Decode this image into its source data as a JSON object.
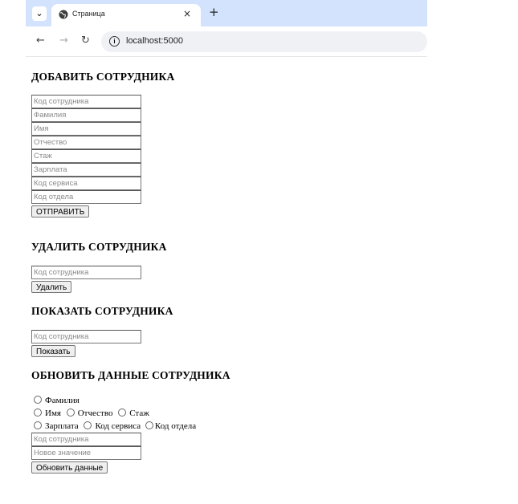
{
  "browser": {
    "tab_title": "Страница",
    "tab_close": "×",
    "new_tab": "+",
    "url": "localhost:5000",
    "icons": {
      "tab_menu": "chevron-down-icon",
      "favicon": "globe-icon",
      "back": "back-arrow-icon",
      "forward": "forward-arrow-icon",
      "reload": "reload-icon",
      "site_info": "info-icon"
    }
  },
  "add_employee": {
    "title": "ДОБАВИТЬ СОТРУДНИКА",
    "fields": [
      {
        "placeholder": "Код сотрудника",
        "value": ""
      },
      {
        "placeholder": "Фамилия",
        "value": ""
      },
      {
        "placeholder": "Имя",
        "value": ""
      },
      {
        "placeholder": "Отчество",
        "value": ""
      },
      {
        "placeholder": "Стаж",
        "value": ""
      },
      {
        "placeholder": "Зарплата",
        "value": ""
      },
      {
        "placeholder": "Код сервиса",
        "value": ""
      },
      {
        "placeholder": "Код отдела",
        "value": ""
      }
    ],
    "submit_label": "ОТПРАВИТЬ"
  },
  "delete_employee": {
    "title": "УДАЛИТЬ СОТРУДНИКА",
    "field_placeholder": "Код сотрудника",
    "button_label": "Удалить"
  },
  "show_employee": {
    "title": "ПОКАЗАТЬ СОТРУДНИКА",
    "field_placeholder": "Код сотрудника",
    "button_label": "Показать"
  },
  "update_employee": {
    "title": "ОБНОВИТЬ ДАННЫЕ СОТРУДНИКА",
    "radios": [
      "Фамилия",
      "Имя",
      "Отчество",
      "Стаж",
      "Зарплата",
      "Код сервиса",
      "Код отдела"
    ],
    "id_placeholder": "Код сотрудника",
    "value_placeholder": "Новое значение",
    "button_label": "Обновить данные"
  }
}
